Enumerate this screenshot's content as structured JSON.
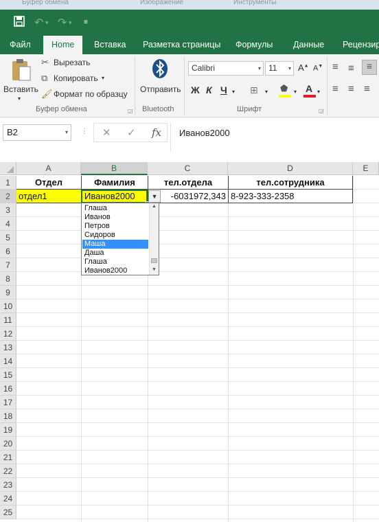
{
  "top_strip": [
    "Буфер обмена",
    "Изображение",
    "Инструменты"
  ],
  "quick_access": {
    "save": "save-icon",
    "undo": "undo-icon",
    "redo": "redo-icon",
    "customize": "customize-icon"
  },
  "tabs": [
    "Файл",
    "Home",
    "Вставка",
    "Разметка страницы",
    "Формулы",
    "Данные",
    "Рецензир"
  ],
  "ribbon": {
    "clipboard": {
      "paste": "Вставить",
      "cut": "Вырезать",
      "copy": "Копировать",
      "format_painter": "Формат по образцу",
      "group": "Буфер обмена"
    },
    "bluetooth": {
      "send": "Отправить",
      "group": "Bluetooth"
    },
    "font": {
      "name": "Calibri",
      "size": "11",
      "bold": "Ж",
      "italic": "К",
      "underline": "Ч",
      "group": "Шрифт"
    }
  },
  "formula_bar": {
    "name_box": "B2",
    "fx": "fx",
    "value": "Иванов2000"
  },
  "columns": [
    "A",
    "B",
    "C",
    "D",
    "E"
  ],
  "rows": [
    "1",
    "2",
    "3",
    "4",
    "5",
    "6",
    "7",
    "8",
    "9",
    "10",
    "11",
    "12",
    "13",
    "14",
    "15",
    "16",
    "17",
    "18",
    "19",
    "20",
    "21",
    "22",
    "23",
    "24",
    "25"
  ],
  "cells": {
    "A1": "Отдел",
    "B1": "Фамилия",
    "C1": "тел.отдела",
    "D1": "тел.сотрудника",
    "A2": "отдел1",
    "B2": "Иванов2000",
    "C2": "-6031972,343",
    "D2": "8-923-333-2358"
  },
  "colors": {
    "excel_green": "#217346",
    "highlight_yellow": "#ffff00",
    "selection_blue": "#3390ff"
  },
  "dropdown_options": [
    "Глаша",
    "Иванов",
    "Петров",
    "Сидоров",
    "Маша",
    "Даша",
    "Глаша",
    "Иванов2000"
  ],
  "dropdown_selected": "Маша"
}
